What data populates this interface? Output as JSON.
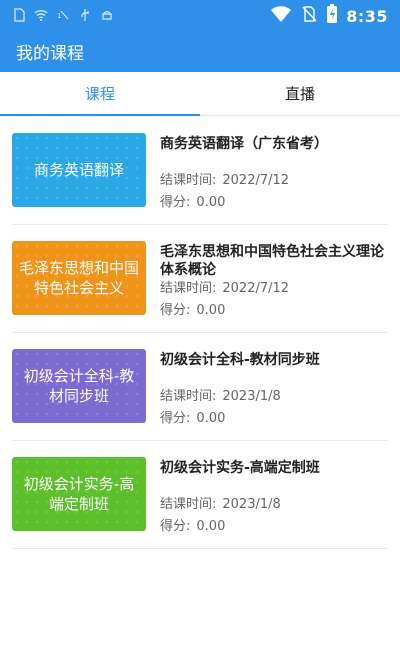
{
  "status": {
    "time": "8:35"
  },
  "app": {
    "title": "我的课程"
  },
  "tabs": [
    {
      "label": "课程",
      "active": true
    },
    {
      "label": "直播",
      "active": false
    }
  ],
  "labels": {
    "end_time": "结课时间:",
    "score": "得分:"
  },
  "courses": [
    {
      "thumb_text": "商务英语翻译",
      "thumb_color": "#2aa8e6",
      "title": "商务英语翻译（广东省考）",
      "end_time": "2022/7/12",
      "score": "0.00"
    },
    {
      "thumb_text": "毛泽东思想和中国特色社会主义",
      "thumb_color": "#f09419",
      "title": "毛泽东思想和中国特色社会主义理论体系概论",
      "end_time": "2022/7/12",
      "score": "0.00"
    },
    {
      "thumb_text": "初级会计全科-教材同步班",
      "thumb_color": "#7b6ad0",
      "title": "初级会计全科-教材同步班",
      "end_time": "2023/1/8",
      "score": "0.00"
    },
    {
      "thumb_text": "初级会计实务-高端定制班",
      "thumb_color": "#5dbf2a",
      "title": "初级会计实务-高端定制班",
      "end_time": "2023/1/8",
      "score": "0.00"
    }
  ]
}
